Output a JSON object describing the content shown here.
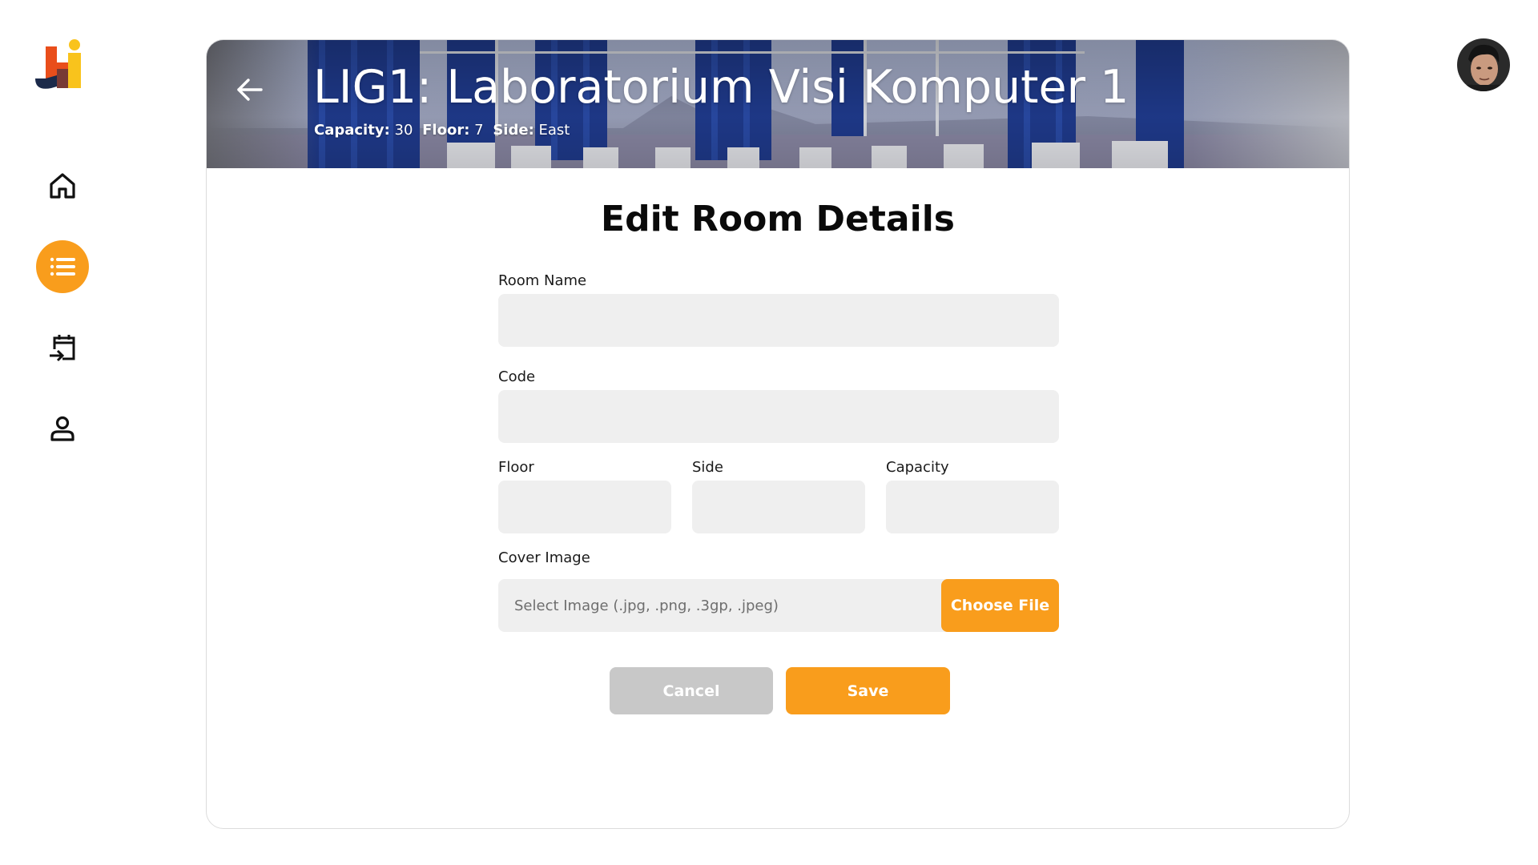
{
  "colors": {
    "accent": "#F99D1C",
    "input_bg": "#EFEFEF",
    "cancel_bg": "#C8C8C8"
  },
  "sidebar": {
    "items": [
      {
        "name": "home",
        "icon": "home-icon",
        "active": false
      },
      {
        "name": "list",
        "icon": "list-icon",
        "active": true
      },
      {
        "name": "schedule",
        "icon": "calendar-enter-icon",
        "active": false
      },
      {
        "name": "profile",
        "icon": "user-icon",
        "active": false
      }
    ]
  },
  "header": {
    "title": "LIG1: Laboratorium Visi Komputer 1",
    "capacity_label": "Capacity:",
    "capacity_value": "30",
    "floor_label": "Floor:",
    "floor_value": "7",
    "side_label": "Side:",
    "side_value": "East"
  },
  "form": {
    "title": "Edit Room Details",
    "room_name_label": "Room Name",
    "room_name_value": "",
    "code_label": "Code",
    "code_value": "",
    "floor_label": "Floor",
    "floor_value": "",
    "side_label": "Side",
    "side_value": "",
    "capacity_label": "Capacity",
    "capacity_value": "",
    "cover_label": "Cover Image",
    "cover_placeholder": "Select Image (.jpg, .png, .3gp, .jpeg)",
    "choose_file_label": "Choose File",
    "cancel_label": "Cancel",
    "save_label": "Save"
  }
}
